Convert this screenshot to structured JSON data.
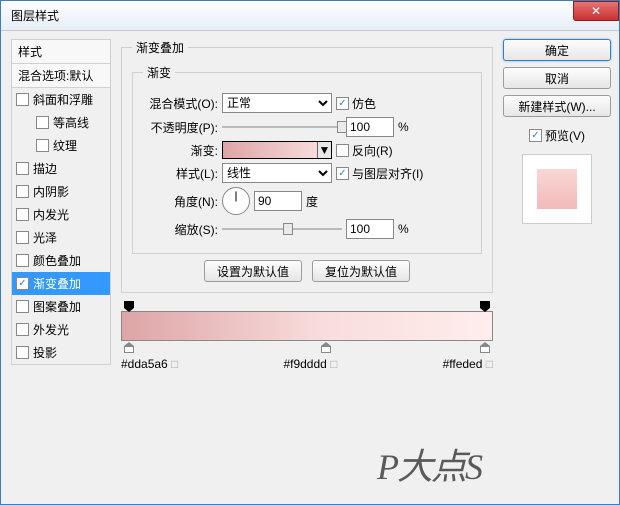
{
  "window": {
    "title": "图层样式"
  },
  "sidebar": {
    "header": "样式",
    "blend_opt": "混合选项:默认",
    "items": [
      {
        "label": "斜面和浮雕",
        "checked": false,
        "selected": false,
        "indent": false
      },
      {
        "label": "等高线",
        "checked": false,
        "selected": false,
        "indent": true
      },
      {
        "label": "纹理",
        "checked": false,
        "selected": false,
        "indent": true
      },
      {
        "label": "描边",
        "checked": false,
        "selected": false,
        "indent": false
      },
      {
        "label": "内阴影",
        "checked": false,
        "selected": false,
        "indent": false
      },
      {
        "label": "内发光",
        "checked": false,
        "selected": false,
        "indent": false
      },
      {
        "label": "光泽",
        "checked": false,
        "selected": false,
        "indent": false
      },
      {
        "label": "颜色叠加",
        "checked": false,
        "selected": false,
        "indent": false
      },
      {
        "label": "渐变叠加",
        "checked": true,
        "selected": true,
        "indent": false
      },
      {
        "label": "图案叠加",
        "checked": false,
        "selected": false,
        "indent": false
      },
      {
        "label": "外发光",
        "checked": false,
        "selected": false,
        "indent": false
      },
      {
        "label": "投影",
        "checked": false,
        "selected": false,
        "indent": false
      }
    ]
  },
  "panel": {
    "group_title": "渐变叠加",
    "sub_title": "渐变",
    "blend_mode_label": "混合模式(O):",
    "blend_mode_value": "正常",
    "dither_label": "仿色",
    "dither_checked": true,
    "opacity_label": "不透明度(P):",
    "opacity_value": "100",
    "opacity_unit": "%",
    "grad_label": "渐变:",
    "reverse_label": "反向(R)",
    "reverse_checked": false,
    "style_label": "样式(L):",
    "style_value": "线性",
    "align_label": "与图层对齐(I)",
    "align_checked": true,
    "angle_label": "角度(N):",
    "angle_value": "90",
    "angle_unit": "度",
    "scale_label": "缩放(S):",
    "scale_value": "100",
    "scale_unit": "%",
    "reset_btn": "设置为默认值",
    "restore_btn": "复位为默认值"
  },
  "gradient": {
    "stops": [
      {
        "pos": 0,
        "color": "#dda5a6"
      },
      {
        "pos": 55,
        "color": "#f9dddd"
      },
      {
        "pos": 100,
        "color": "#ffeded"
      }
    ]
  },
  "actions": {
    "ok": "确定",
    "cancel": "取消",
    "new_style": "新建样式(W)...",
    "preview_label": "预览(V)",
    "preview_checked": true
  },
  "watermark": "P大点S"
}
